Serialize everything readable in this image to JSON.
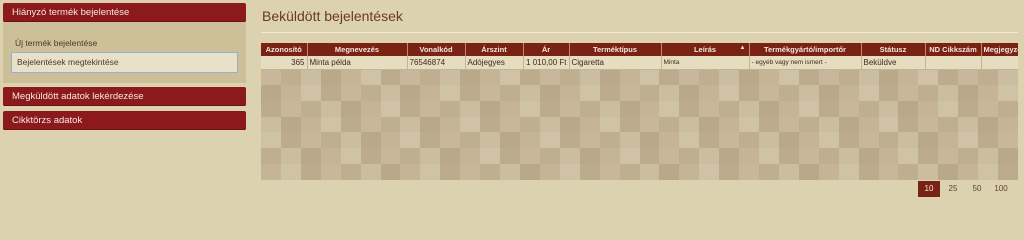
{
  "sidebar": {
    "section1": "Hiányzó termék bejelentése",
    "sub_items": [
      "Új termék bejelentése",
      "Bejelentések megtekintése"
    ],
    "section2": "Megküldött adatok lekérdezése",
    "section3": "Cikktörzs adatok"
  },
  "main": {
    "title": "Beküldött bejelentések",
    "table": {
      "headers": [
        "Azonosító",
        "Megnevezés",
        "Vonalkód",
        "Árszint",
        "Ár",
        "Terméktípus",
        "Leírás",
        "Termékgyártó/importőr",
        "Státusz",
        "ND Cikkszám",
        "Megjegyzés"
      ],
      "rows": [
        [
          "365",
          "Minta példa",
          "76546874",
          "Adójegyes",
          "1 010,00 Ft",
          "Cigaretta",
          "Minta",
          "- egyéb vagy nem ismert -",
          "Beküldve",
          "",
          ""
        ]
      ]
    },
    "pager": {
      "sizes": [
        "10",
        "25",
        "50",
        "100"
      ],
      "active": "10"
    }
  },
  "icons": {
    "sort": "sort-arrows-icon"
  },
  "colors": {
    "accent": "#8c1a1c",
    "header": "#7a2214",
    "background": "#dcd2b0"
  }
}
